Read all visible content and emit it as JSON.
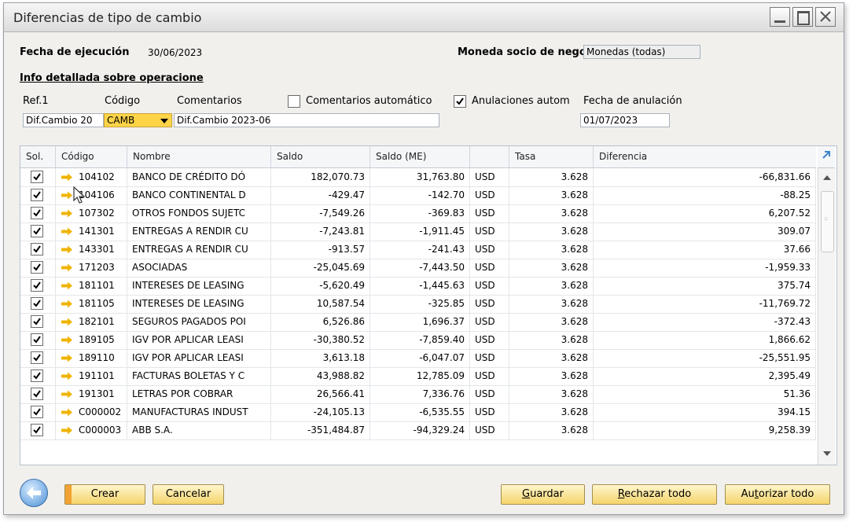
{
  "window": {
    "title": "Diferencias de tipo de cambio",
    "controls": {
      "minimize": "minimize",
      "maximize": "maximize",
      "close": "close"
    }
  },
  "header": {
    "exec_date_label": "Fecha de ejecución",
    "exec_date_value": "30/06/2023",
    "currency_label": "Moneda socio de negoci",
    "currency_value": "Monedas (todas)",
    "section_title": "Info detallada sobre operacione"
  },
  "ops": {
    "ref1_label": "Ref.1",
    "ref1_value": "Dif.Cambio 20",
    "codigo_label": "Código",
    "codigo_value": "CAMB",
    "comentarios_label": "Comentarios",
    "comentarios_value": "Dif.Cambio 2023-06",
    "auto_comments_label": "Comentarios automático",
    "auto_comments_checked": false,
    "auto_cancel_label": "Anulaciones autom",
    "auto_cancel_checked": true,
    "cancel_date_label": "Fecha de anulación",
    "cancel_date_value": "01/07/2023"
  },
  "table": {
    "headers": [
      "Sol.",
      "Código",
      "Nombre",
      "Saldo",
      "Saldo (ME)",
      "",
      "Tasa",
      "Diferencia"
    ],
    "rows": [
      {
        "code": "104102",
        "name": "BANCO DE CRÉDITO DÓ",
        "saldo": "182,070.73",
        "saldo_me": "31,763.80",
        "cur": "USD",
        "tasa": "3.628",
        "dif": "-66,831.66"
      },
      {
        "code": "104106",
        "name": "BANCO CONTINENTAL D",
        "saldo": "-429.47",
        "saldo_me": "-142.70",
        "cur": "USD",
        "tasa": "3.628",
        "dif": "-88.25"
      },
      {
        "code": "107302",
        "name": "OTROS FONDOS SUJETC",
        "saldo": "-7,549.26",
        "saldo_me": "-369.83",
        "cur": "USD",
        "tasa": "3.628",
        "dif": "6,207.52"
      },
      {
        "code": "141301",
        "name": "ENTREGAS A RENDIR CU",
        "saldo": "-7,243.81",
        "saldo_me": "-1,911.45",
        "cur": "USD",
        "tasa": "3.628",
        "dif": "309.07"
      },
      {
        "code": "143301",
        "name": "ENTREGAS A RENDIR CU",
        "saldo": "-913.57",
        "saldo_me": "-241.43",
        "cur": "USD",
        "tasa": "3.628",
        "dif": "37.66"
      },
      {
        "code": "171203",
        "name": "ASOCIADAS",
        "saldo": "-25,045.69",
        "saldo_me": "-7,443.50",
        "cur": "USD",
        "tasa": "3.628",
        "dif": "-1,959.33"
      },
      {
        "code": "181101",
        "name": "INTERESES DE LEASING",
        "saldo": "-5,620.49",
        "saldo_me": "-1,445.63",
        "cur": "USD",
        "tasa": "3.628",
        "dif": "375.74"
      },
      {
        "code": "181105",
        "name": "INTERESES DE LEASING",
        "saldo": "10,587.54",
        "saldo_me": "-325.85",
        "cur": "USD",
        "tasa": "3.628",
        "dif": "-11,769.72"
      },
      {
        "code": "182101",
        "name": "SEGUROS PAGADOS POI",
        "saldo": "6,526.86",
        "saldo_me": "1,696.37",
        "cur": "USD",
        "tasa": "3.628",
        "dif": "-372.43"
      },
      {
        "code": "189105",
        "name": "IGV POR APLICAR LEASI",
        "saldo": "-30,380.52",
        "saldo_me": "-7,859.40",
        "cur": "USD",
        "tasa": "3.628",
        "dif": "1,866.62"
      },
      {
        "code": "189110",
        "name": "IGV POR APLICAR LEASI",
        "saldo": "3,613.18",
        "saldo_me": "-6,047.07",
        "cur": "USD",
        "tasa": "3.628",
        "dif": "-25,551.95"
      },
      {
        "code": "191101",
        "name": "FACTURAS BOLETAS Y C",
        "saldo": "43,988.82",
        "saldo_me": "12,785.09",
        "cur": "USD",
        "tasa": "3.628",
        "dif": "2,395.49"
      },
      {
        "code": "191301",
        "name": "LETRAS POR COBRAR",
        "saldo": "26,566.41",
        "saldo_me": "7,336.76",
        "cur": "USD",
        "tasa": "3.628",
        "dif": "51.36"
      },
      {
        "code": "C000002",
        "name": "MANUFACTURAS INDUST",
        "saldo": "-24,105.13",
        "saldo_me": "-6,535.55",
        "cur": "USD",
        "tasa": "3.628",
        "dif": "394.15"
      },
      {
        "code": "C000003",
        "name": "ABB S.A.",
        "saldo": "-351,484.87",
        "saldo_me": "-94,329.24",
        "cur": "USD",
        "tasa": "3.628",
        "dif": "9,258.39"
      }
    ]
  },
  "buttons": {
    "crear": "Crear",
    "cancelar": "Cancelar",
    "guardar_acc": "G",
    "guardar_rest": "uardar",
    "rechazar_acc": "R",
    "rechazar_rest": "echazar todo",
    "autorizar_pre": "Au",
    "autorizar_acc": "t",
    "autorizar_rest": "orizar todo"
  },
  "icons": {
    "back": "back-arrow-icon",
    "row_link": "link-arrow-icon",
    "expand": "expand-icon"
  },
  "colors": {
    "accent_yellow": "#ffd447",
    "link_arrow": "#f0b400",
    "button_gradient_top": "#fff6cc",
    "button_gradient_bottom": "#f4d46b"
  }
}
